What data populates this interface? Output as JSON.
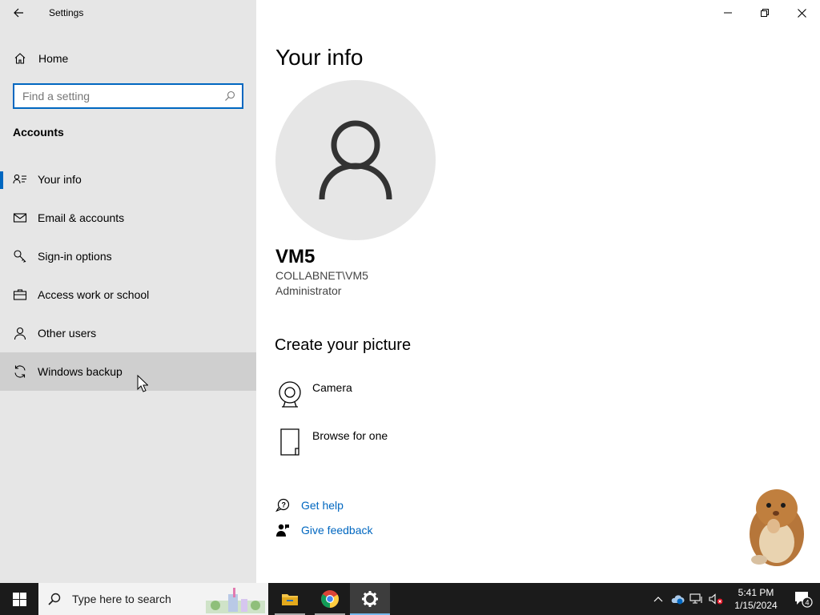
{
  "window": {
    "title": "Settings"
  },
  "sidebar": {
    "home_label": "Home",
    "search_placeholder": "Find a setting",
    "section_title": "Accounts",
    "items": [
      {
        "label": "Your info",
        "icon": "contact-card-icon",
        "active": true
      },
      {
        "label": "Email & accounts",
        "icon": "mail-icon"
      },
      {
        "label": "Sign-in options",
        "icon": "key-icon"
      },
      {
        "label": "Access work or school",
        "icon": "briefcase-icon"
      },
      {
        "label": "Other users",
        "icon": "person-icon"
      },
      {
        "label": "Windows backup",
        "icon": "sync-icon",
        "hovered": true
      }
    ]
  },
  "main": {
    "title": "Your info",
    "user": {
      "name": "VM5",
      "domain": "COLLABNET\\VM5",
      "role": "Administrator"
    },
    "create_title": "Create your picture",
    "options": [
      {
        "label": "Camera",
        "icon": "camera-icon"
      },
      {
        "label": "Browse for one",
        "icon": "file-icon"
      }
    ],
    "links": [
      {
        "label": "Get help",
        "icon": "help-chat-icon"
      },
      {
        "label": "Give feedback",
        "icon": "feedback-person-icon"
      }
    ]
  },
  "taskbar": {
    "search_placeholder": "Type here to search",
    "apps": [
      "file-explorer-icon",
      "chrome-icon",
      "settings-gear-icon"
    ],
    "time": "5:41 PM",
    "date": "1/15/2024",
    "notification_count": "4"
  },
  "colors": {
    "accent": "#0067c0",
    "sidebar_bg": "#e6e6e6",
    "taskbar_bg": "#1b1b1b"
  }
}
